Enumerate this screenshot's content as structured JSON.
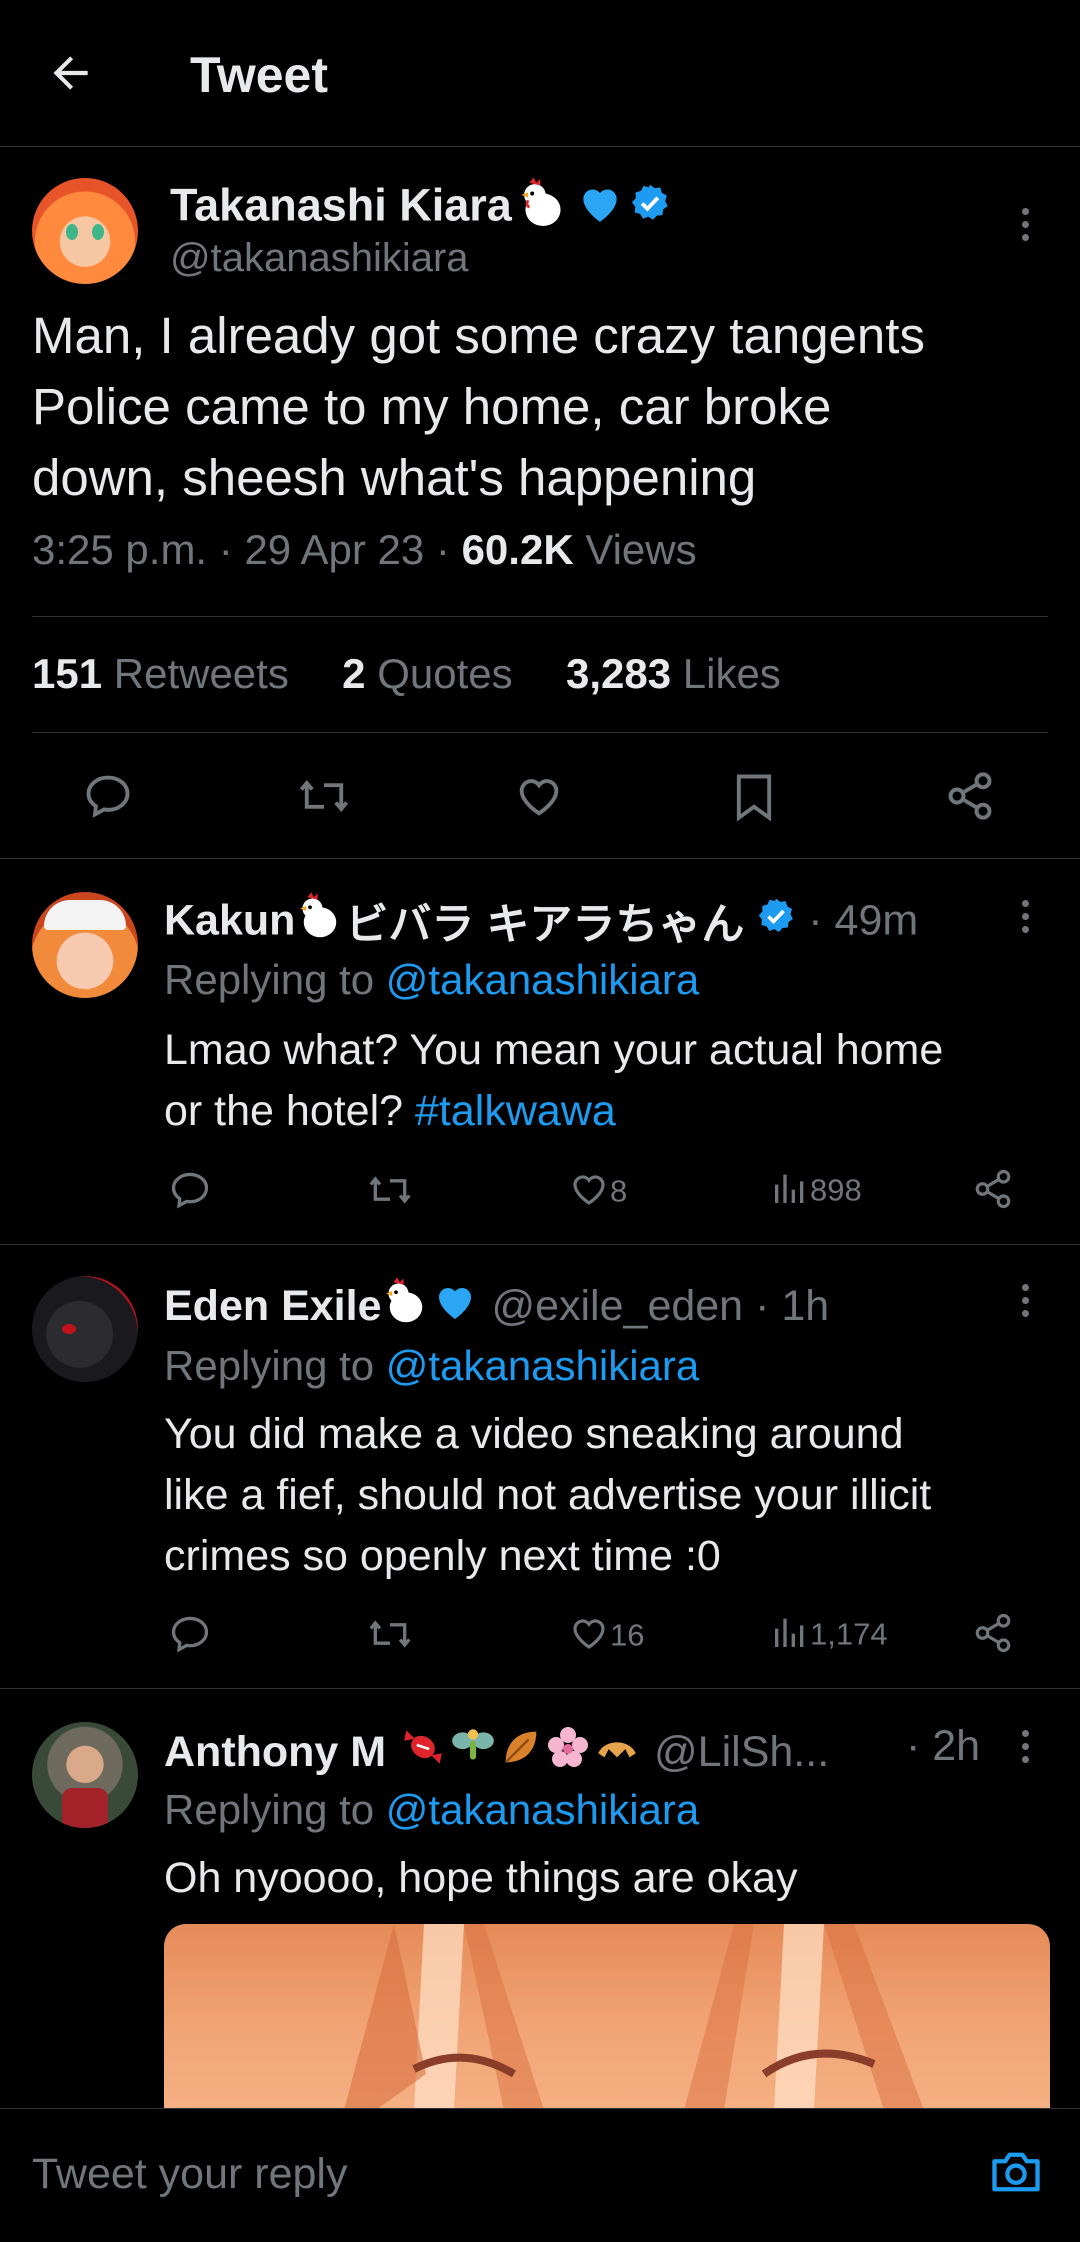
{
  "header": {
    "title": "Tweet"
  },
  "main_tweet": {
    "name": "Takanashi Kiara",
    "handle": "@takanashikiara",
    "text_lines": [
      "Man, I already got some crazy tangents",
      "Police came to my home, car broke",
      "down, sheesh what's happening"
    ],
    "time": "3:25 p.m.",
    "date": "29 Apr 23",
    "views_count": "60.2K",
    "views_label": "Views",
    "retweets_count": "151",
    "retweets_label": "Retweets",
    "quotes_count": "2",
    "quotes_label": "Quotes",
    "likes_count": "3,283",
    "likes_label": "Likes"
  },
  "replies": [
    {
      "name": "Kakun",
      "name_suffix": "ビバラ キアラちゃん",
      "handle": "",
      "time": "· 49m",
      "replying_prefix": "Replying to",
      "replying_to": "@takanashikiara",
      "text_lines": [
        "Lmao what? You mean your actual home",
        "or the hotel?"
      ],
      "hashtag": "#talkwawa",
      "likes": "8",
      "views": "898"
    },
    {
      "name": "Eden Exile",
      "handle": "@exile_eden",
      "time": "· 1h",
      "replying_prefix": "Replying to",
      "replying_to": "@takanashikiara",
      "text_lines": [
        "You did make a video sneaking around",
        "like a fief, should not advertise your illicit",
        "crimes so openly next time :0"
      ],
      "likes": "16",
      "views": "1,174"
    },
    {
      "name": "Anthony M",
      "handle": "@LilSh...",
      "time": "· 2h",
      "replying_prefix": "Replying to",
      "replying_to": "@takanashikiara",
      "text_lines": [
        "Oh nyoooo, hope things are okay"
      ]
    }
  ],
  "composer": {
    "placeholder": "Tweet your reply"
  },
  "colors": {
    "background": "#000000",
    "accent": "#1d9bf0",
    "muted": "#71767b",
    "text": "#e7e9ea",
    "divider": "#2f3336"
  }
}
